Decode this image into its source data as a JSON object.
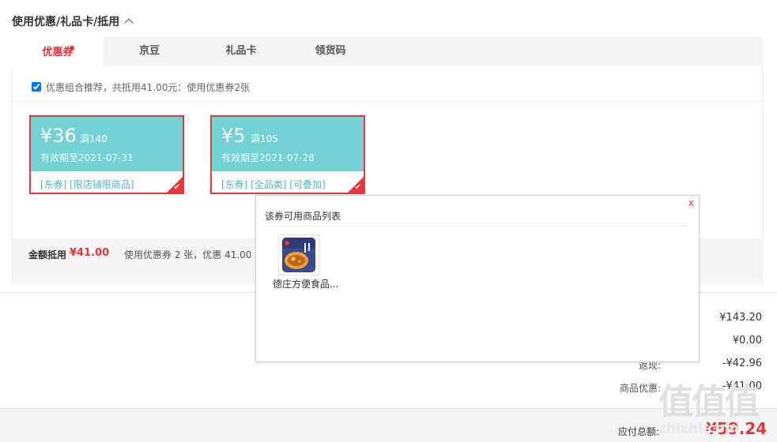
{
  "section": {
    "title": "使用优惠/礼品卡/抵用"
  },
  "tabs": [
    {
      "label": "优惠券",
      "active": true,
      "has_dot": true
    },
    {
      "label": "京豆",
      "active": false
    },
    {
      "label": "礼品卡",
      "active": false
    },
    {
      "label": "领货码",
      "active": false
    }
  ],
  "combo": {
    "checked": true,
    "text": "优惠组合推荐，共抵用41.00元：使用优惠券2张"
  },
  "coupons": [
    {
      "amount": "¥36",
      "condition": "满140",
      "expiry": "有效期至2021-07-31",
      "tags": "[东券]  [限店铺限商品]",
      "selected": true
    },
    {
      "amount": "¥5",
      "condition": "满105",
      "expiry": "有效期至2021-07-28",
      "tags": "[东券]  [全品类]  [可叠加]",
      "selected": true
    }
  ],
  "summary": {
    "label": "金额抵用",
    "amount": "¥41.00",
    "desc": "使用优惠券 2 张，优惠 41.00"
  },
  "prices": [
    {
      "label": "",
      "value": "¥143.20"
    },
    {
      "label": "",
      "value": "¥0.00"
    },
    {
      "label": "返现:",
      "value": "-¥42.96"
    },
    {
      "label": "商品优惠:",
      "value": "-¥41.00"
    }
  ],
  "total": {
    "label": "应付总额:",
    "amount": "¥59.24"
  },
  "popup": {
    "title": "该券可用商品列表",
    "close": "x",
    "products": [
      {
        "name": "德庄方便食品..."
      }
    ]
  },
  "watermark": {
    "text": "值值值",
    "url": "zhizhi.com"
  },
  "colors": {
    "accent": "#e4393c",
    "coupon_bg": "#74d2d4",
    "tag": "#5ab6bb"
  }
}
